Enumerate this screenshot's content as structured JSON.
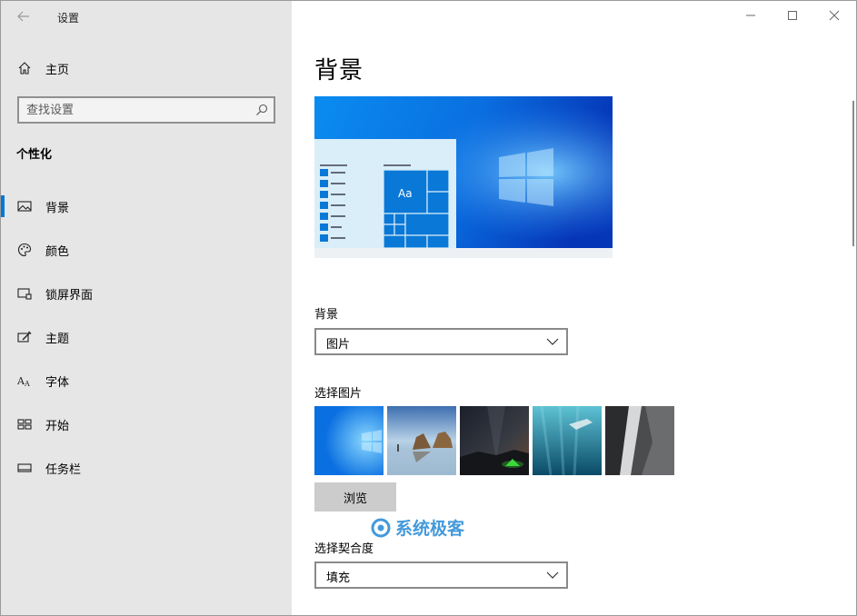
{
  "window": {
    "title": "设置",
    "controls": {
      "minimize_icon": "minimize-icon",
      "maximize_icon": "maximize-icon",
      "close_icon": "close-icon"
    }
  },
  "sidebar": {
    "home_label": "主页",
    "search_placeholder": "查找设置",
    "section_title": "个性化",
    "items": [
      {
        "label": "背景",
        "icon": "picture-icon",
        "active": true
      },
      {
        "label": "颜色",
        "icon": "palette-icon",
        "active": false
      },
      {
        "label": "锁屏界面",
        "icon": "lock-screen-icon",
        "active": false
      },
      {
        "label": "主题",
        "icon": "theme-brush-icon",
        "active": false
      },
      {
        "label": "字体",
        "icon": "font-icon",
        "active": false
      },
      {
        "label": "开始",
        "icon": "start-grid-icon",
        "active": false
      },
      {
        "label": "任务栏",
        "icon": "taskbar-icon",
        "active": false
      }
    ]
  },
  "main": {
    "title": "背景",
    "preview": {
      "tile_text": "Aa"
    },
    "background_label": "背景",
    "background_value": "图片",
    "choose_picture_label": "选择图片",
    "browse_label": "浏览",
    "fit_label": "选择契合度",
    "fit_value": "填充"
  },
  "watermark": {
    "text": "系统极客"
  },
  "colors": {
    "accent": "#0078d7",
    "sidebar_bg": "#e6e6e6"
  }
}
